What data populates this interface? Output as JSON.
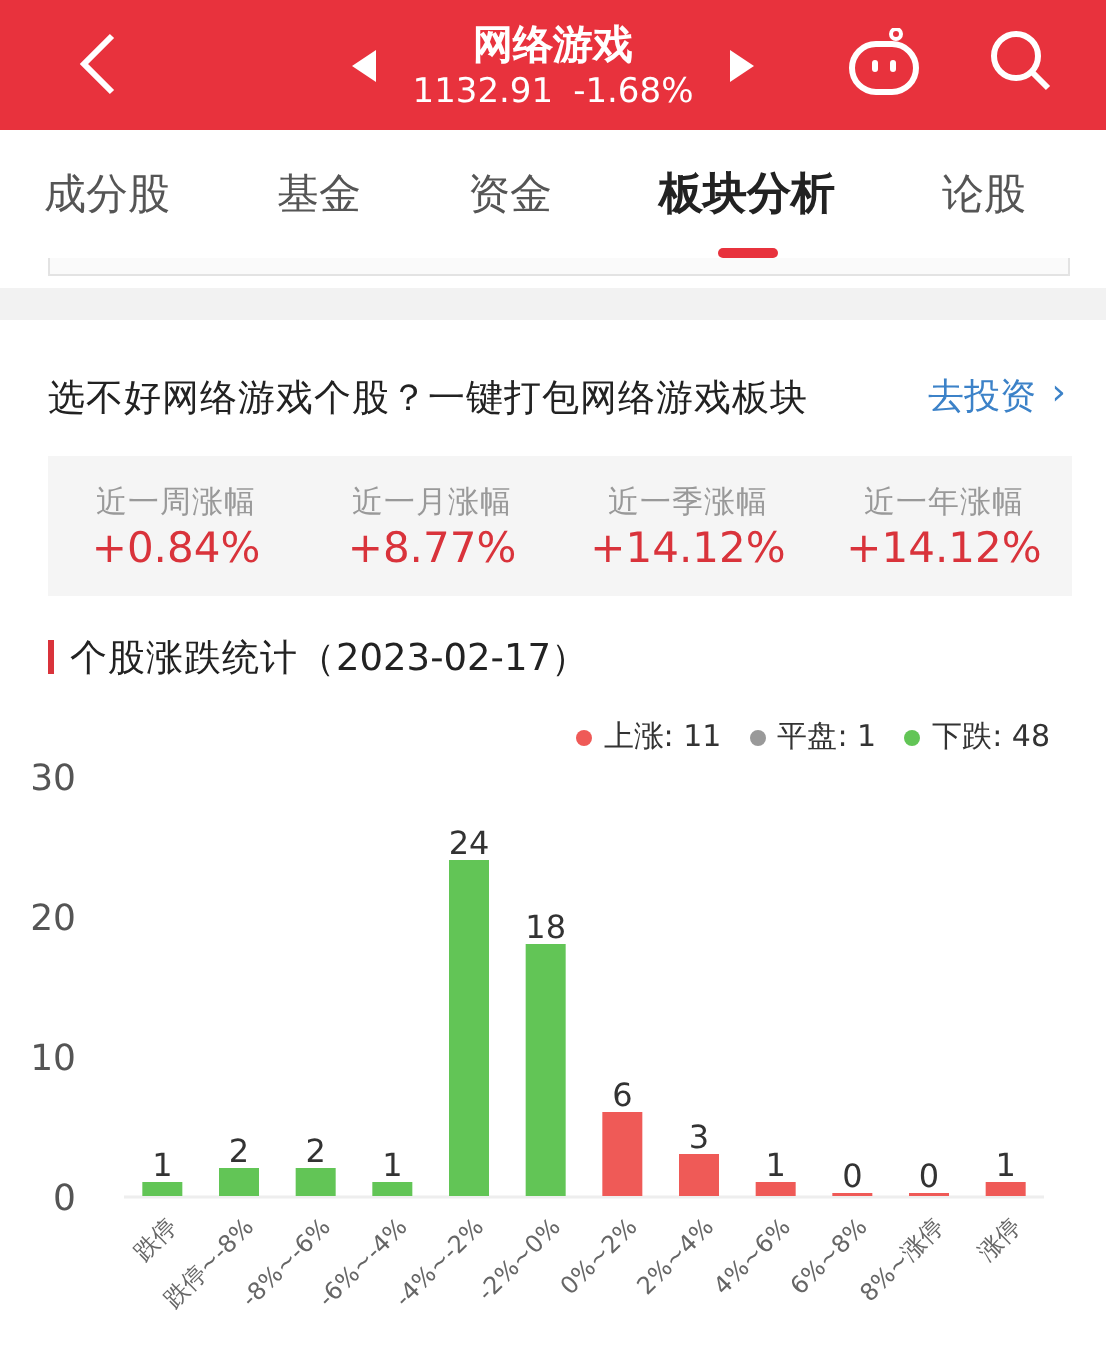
{
  "header": {
    "title": "网络游戏",
    "price": "1132.91",
    "change": "-1.68%"
  },
  "tabs": [
    {
      "label": "成分股",
      "selected": false
    },
    {
      "label": "基金",
      "selected": false
    },
    {
      "label": "资金",
      "selected": false
    },
    {
      "label": "板块分析",
      "selected": true
    },
    {
      "label": "论股",
      "selected": false
    }
  ],
  "promo": {
    "text": "选不好网络游戏个股？一键打包网络游戏板块",
    "link": "去投资",
    "arrow": "›"
  },
  "stats": [
    {
      "label": "近一周涨幅",
      "value": "+0.84%"
    },
    {
      "label": "近一月涨幅",
      "value": "+8.77%"
    },
    {
      "label": "近一季涨幅",
      "value": "+14.12%"
    },
    {
      "label": "近一年涨幅",
      "value": "+14.12%"
    }
  ],
  "section": {
    "title": "个股涨跌统计（2023-02-17）"
  },
  "legend": [
    {
      "label": "上涨: 11",
      "color": "#ef5a57"
    },
    {
      "label": "平盘: 1",
      "color": "#999999"
    },
    {
      "label": "下跌: 48",
      "color": "#62c556"
    }
  ],
  "chart_data": {
    "type": "bar",
    "categories": [
      "跌停",
      "跌停~-8%",
      "-8%~-6%",
      "-6%~-4%",
      "-4%~-2%",
      "-2%~0%",
      "0%~2%",
      "2%~4%",
      "4%~6%",
      "6%~8%",
      "8%~涨停",
      "涨停"
    ],
    "series": [
      {
        "color": "#62c556",
        "values": [
          1,
          2,
          2,
          1,
          24,
          18,
          null,
          null,
          null,
          null,
          null,
          null
        ]
      },
      {
        "color": "#ef5a57",
        "values": [
          null,
          null,
          null,
          null,
          null,
          null,
          6,
          3,
          1,
          0,
          0,
          1
        ]
      }
    ],
    "ylim": [
      0,
      30
    ],
    "yticks": [
      0,
      10,
      20,
      30
    ],
    "data_labels": true
  }
}
